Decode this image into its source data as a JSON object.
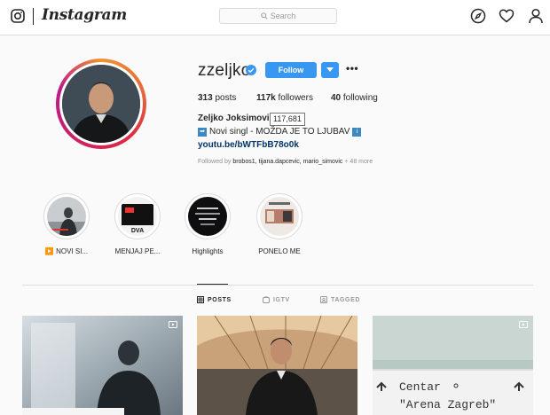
{
  "topbar": {
    "logo_text": "Instagram",
    "search_placeholder": "Search",
    "icons": [
      "instagram-glyph-icon",
      "compass-icon",
      "heart-icon",
      "person-icon"
    ]
  },
  "profile": {
    "username": "zzeljko",
    "follow_label": "Follow",
    "stats": {
      "posts_count": "313",
      "posts_label": "posts",
      "followers_count": "117k",
      "followers_label": "followers",
      "following_count": "40",
      "following_label": "following"
    },
    "followers_tooltip": "117,681",
    "full_name": "Zeljko Joksimovic",
    "bio_text": "Novi singl - MOŽDA JE TO LJUBAV",
    "bio_link": "youtu.be/bWTFbB78o0k",
    "followed_by_prefix": "Followed by",
    "followed_by_names": "brobos1, tijana.dapcevic, mario_simovic",
    "followed_by_more": "+ 48 more"
  },
  "highlights": [
    {
      "label": "▶️ NOVI SI..."
    },
    {
      "label": "MENJAJ PE..."
    },
    {
      "label": "Highlights"
    },
    {
      "label": "PONELO ME"
    }
  ],
  "tabs": [
    {
      "label": "POSTS",
      "active": true
    },
    {
      "label": "IGTV",
      "active": false
    },
    {
      "label": "TAGGED",
      "active": false
    }
  ],
  "posts": [
    {
      "type": "video"
    },
    {
      "type": "photo"
    },
    {
      "type": "video",
      "sign_line1": "Centar",
      "sign_line2": "\"Arena Zagreb\""
    }
  ],
  "colors": {
    "accent": "#3897f0",
    "link": "#003569",
    "border": "#dbdbdb",
    "muted": "#8e8e8e"
  }
}
